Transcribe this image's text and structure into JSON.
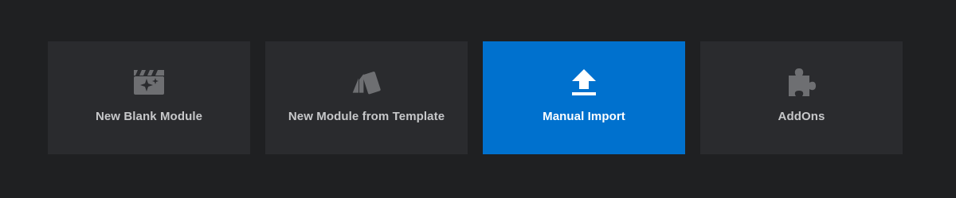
{
  "cards": [
    {
      "label": "New Blank Module",
      "icon": "clapperboard-sparkle-icon",
      "active": false
    },
    {
      "label": "New Module from Template",
      "icon": "template-cards-icon",
      "active": false
    },
    {
      "label": "Manual Import",
      "icon": "upload-icon",
      "active": true
    },
    {
      "label": "AddOns",
      "icon": "puzzle-piece-icon",
      "active": false
    }
  ],
  "colors": {
    "background": "#1f2022",
    "card": "#2a2b2e",
    "active_card": "#0071ce",
    "icon": "#6e6f72",
    "label": "#c7c8ca",
    "active_label": "#ffffff"
  }
}
